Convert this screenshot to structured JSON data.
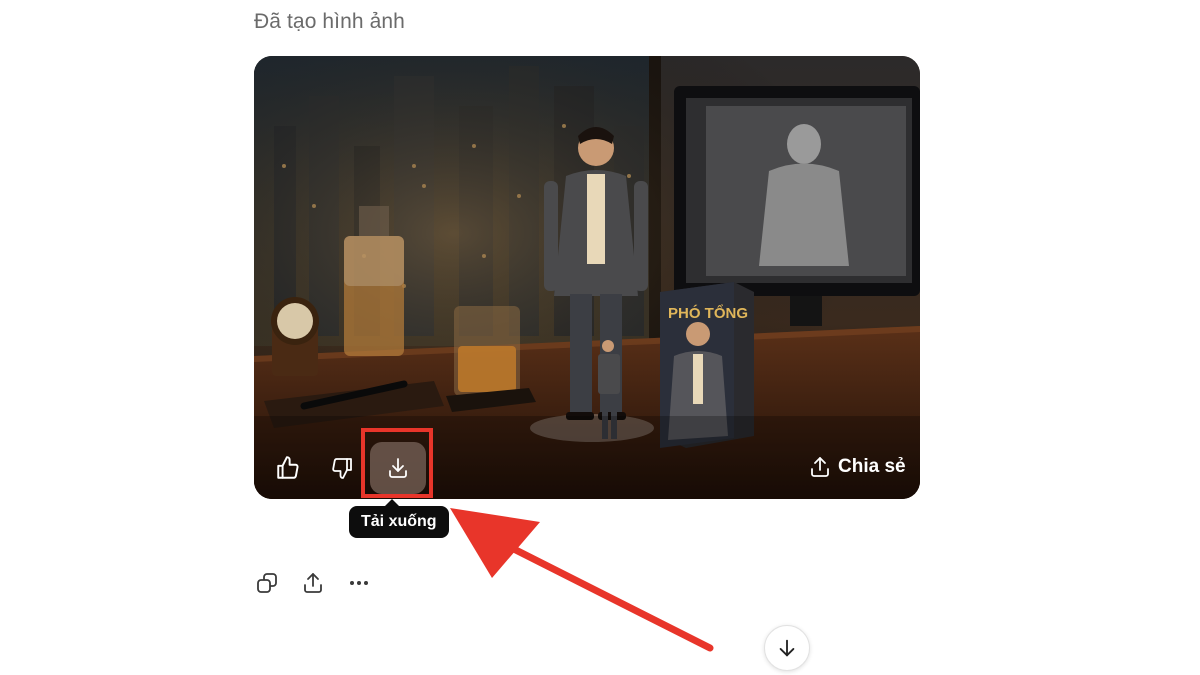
{
  "status": {
    "text": "Đã tạo hình ảnh"
  },
  "image": {
    "box_text": "PHÓ TỔNG"
  },
  "image_overlay": {
    "like_icon": "thumbs-up-icon",
    "dislike_icon": "thumbs-down-icon",
    "download_icon": "download-icon",
    "share_label": "Chia sẻ",
    "share_icon": "share-icon"
  },
  "tooltip": {
    "text": "Tải xuống"
  },
  "annotation": {
    "highlight_color": "#e8352a",
    "arrow_color": "#e8352a"
  },
  "actions": {
    "items": [
      {
        "icon": "copy-icon"
      },
      {
        "icon": "share-icon"
      },
      {
        "icon": "more-icon"
      }
    ]
  },
  "scroll_button": {
    "icon": "arrow-down-icon"
  }
}
